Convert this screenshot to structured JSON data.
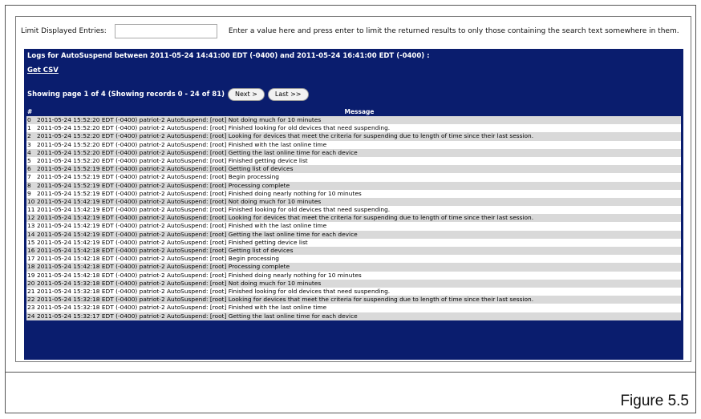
{
  "figure_caption": "Figure 5.5",
  "filter": {
    "label": "Limit Displayed Entries:",
    "value": "",
    "help": "Enter a value here and press enter to limit the returned results to only those containing the search text somewhere in them."
  },
  "log": {
    "title": "Logs for AutoSuspend between 2011-05-24 14:41:00 EDT (-0400) and 2011-05-24 16:41:00 EDT (-0400) :",
    "csv_link": "Get CSV",
    "paging_text": "Showing page 1 of 4 (Showing records 0 - 24 of 81)",
    "next_label": "Next >",
    "last_label": "Last >>",
    "col_num": "#",
    "col_msg": "Message",
    "rows": [
      {
        "n": "0",
        "msg": "2011-05-24 15:52:20 EDT (-0400) patriot-2 AutoSuspend: [root] Not doing much for 10 minutes"
      },
      {
        "n": "1",
        "msg": "2011-05-24 15:52:20 EDT (-0400) patriot-2 AutoSuspend: [root] Finished looking for old devices that need suspending."
      },
      {
        "n": "2",
        "msg": "2011-05-24 15:52:20 EDT (-0400) patriot-2 AutoSuspend: [root] Looking for devices that meet the criteria for suspending due to length of time since their last session."
      },
      {
        "n": "3",
        "msg": "2011-05-24 15:52:20 EDT (-0400) patriot-2 AutoSuspend: [root] Finished with the last online time"
      },
      {
        "n": "4",
        "msg": "2011-05-24 15:52:20 EDT (-0400) patriot-2 AutoSuspend: [root] Getting the last online time for each device"
      },
      {
        "n": "5",
        "msg": "2011-05-24 15:52:20 EDT (-0400) patriot-2 AutoSuspend: [root] Finished getting device list"
      },
      {
        "n": "6",
        "msg": "2011-05-24 15:52:19 EDT (-0400) patriot-2 AutoSuspend: [root] Getting list of devices"
      },
      {
        "n": "7",
        "msg": "2011-05-24 15:52:19 EDT (-0400) patriot-2 AutoSuspend: [root] Begin processing"
      },
      {
        "n": "8",
        "msg": "2011-05-24 15:52:19 EDT (-0400) patriot-2 AutoSuspend: [root] Processing complete"
      },
      {
        "n": "9",
        "msg": "2011-05-24 15:52:19 EDT (-0400) patriot-2 AutoSuspend: [root] Finished doing nearly nothing for 10 minutes"
      },
      {
        "n": "10",
        "msg": "2011-05-24 15:42:19 EDT (-0400) patriot-2 AutoSuspend: [root] Not doing much for 10 minutes"
      },
      {
        "n": "11",
        "msg": "2011-05-24 15:42:19 EDT (-0400) patriot-2 AutoSuspend: [root] Finished looking for old devices that need suspending."
      },
      {
        "n": "12",
        "msg": "2011-05-24 15:42:19 EDT (-0400) patriot-2 AutoSuspend: [root] Looking for devices that meet the criteria for suspending due to length of time since their last session."
      },
      {
        "n": "13",
        "msg": "2011-05-24 15:42:19 EDT (-0400) patriot-2 AutoSuspend: [root] Finished with the last online time"
      },
      {
        "n": "14",
        "msg": "2011-05-24 15:42:19 EDT (-0400) patriot-2 AutoSuspend: [root] Getting the last online time for each device"
      },
      {
        "n": "15",
        "msg": "2011-05-24 15:42:19 EDT (-0400) patriot-2 AutoSuspend: [root] Finished getting device list"
      },
      {
        "n": "16",
        "msg": "2011-05-24 15:42:18 EDT (-0400) patriot-2 AutoSuspend: [root] Getting list of devices"
      },
      {
        "n": "17",
        "msg": "2011-05-24 15:42:18 EDT (-0400) patriot-2 AutoSuspend: [root] Begin processing"
      },
      {
        "n": "18",
        "msg": "2011-05-24 15:42:18 EDT (-0400) patriot-2 AutoSuspend: [root] Processing complete"
      },
      {
        "n": "19",
        "msg": "2011-05-24 15:42:18 EDT (-0400) patriot-2 AutoSuspend: [root] Finished doing nearly nothing for 10 minutes"
      },
      {
        "n": "20",
        "msg": "2011-05-24 15:32:18 EDT (-0400) patriot-2 AutoSuspend: [root] Not doing much for 10 minutes"
      },
      {
        "n": "21",
        "msg": "2011-05-24 15:32:18 EDT (-0400) patriot-2 AutoSuspend: [root] Finished looking for old devices that need suspending."
      },
      {
        "n": "22",
        "msg": "2011-05-24 15:32:18 EDT (-0400) patriot-2 AutoSuspend: [root] Looking for devices that meet the criteria for suspending due to length of time since their last session."
      },
      {
        "n": "23",
        "msg": "2011-05-24 15:32:18 EDT (-0400) patriot-2 AutoSuspend: [root] Finished with the last online time"
      },
      {
        "n": "24",
        "msg": "2011-05-24 15:32:17 EDT (-0400) patriot-2 AutoSuspend: [root] Getting the last online time for each device"
      }
    ]
  }
}
